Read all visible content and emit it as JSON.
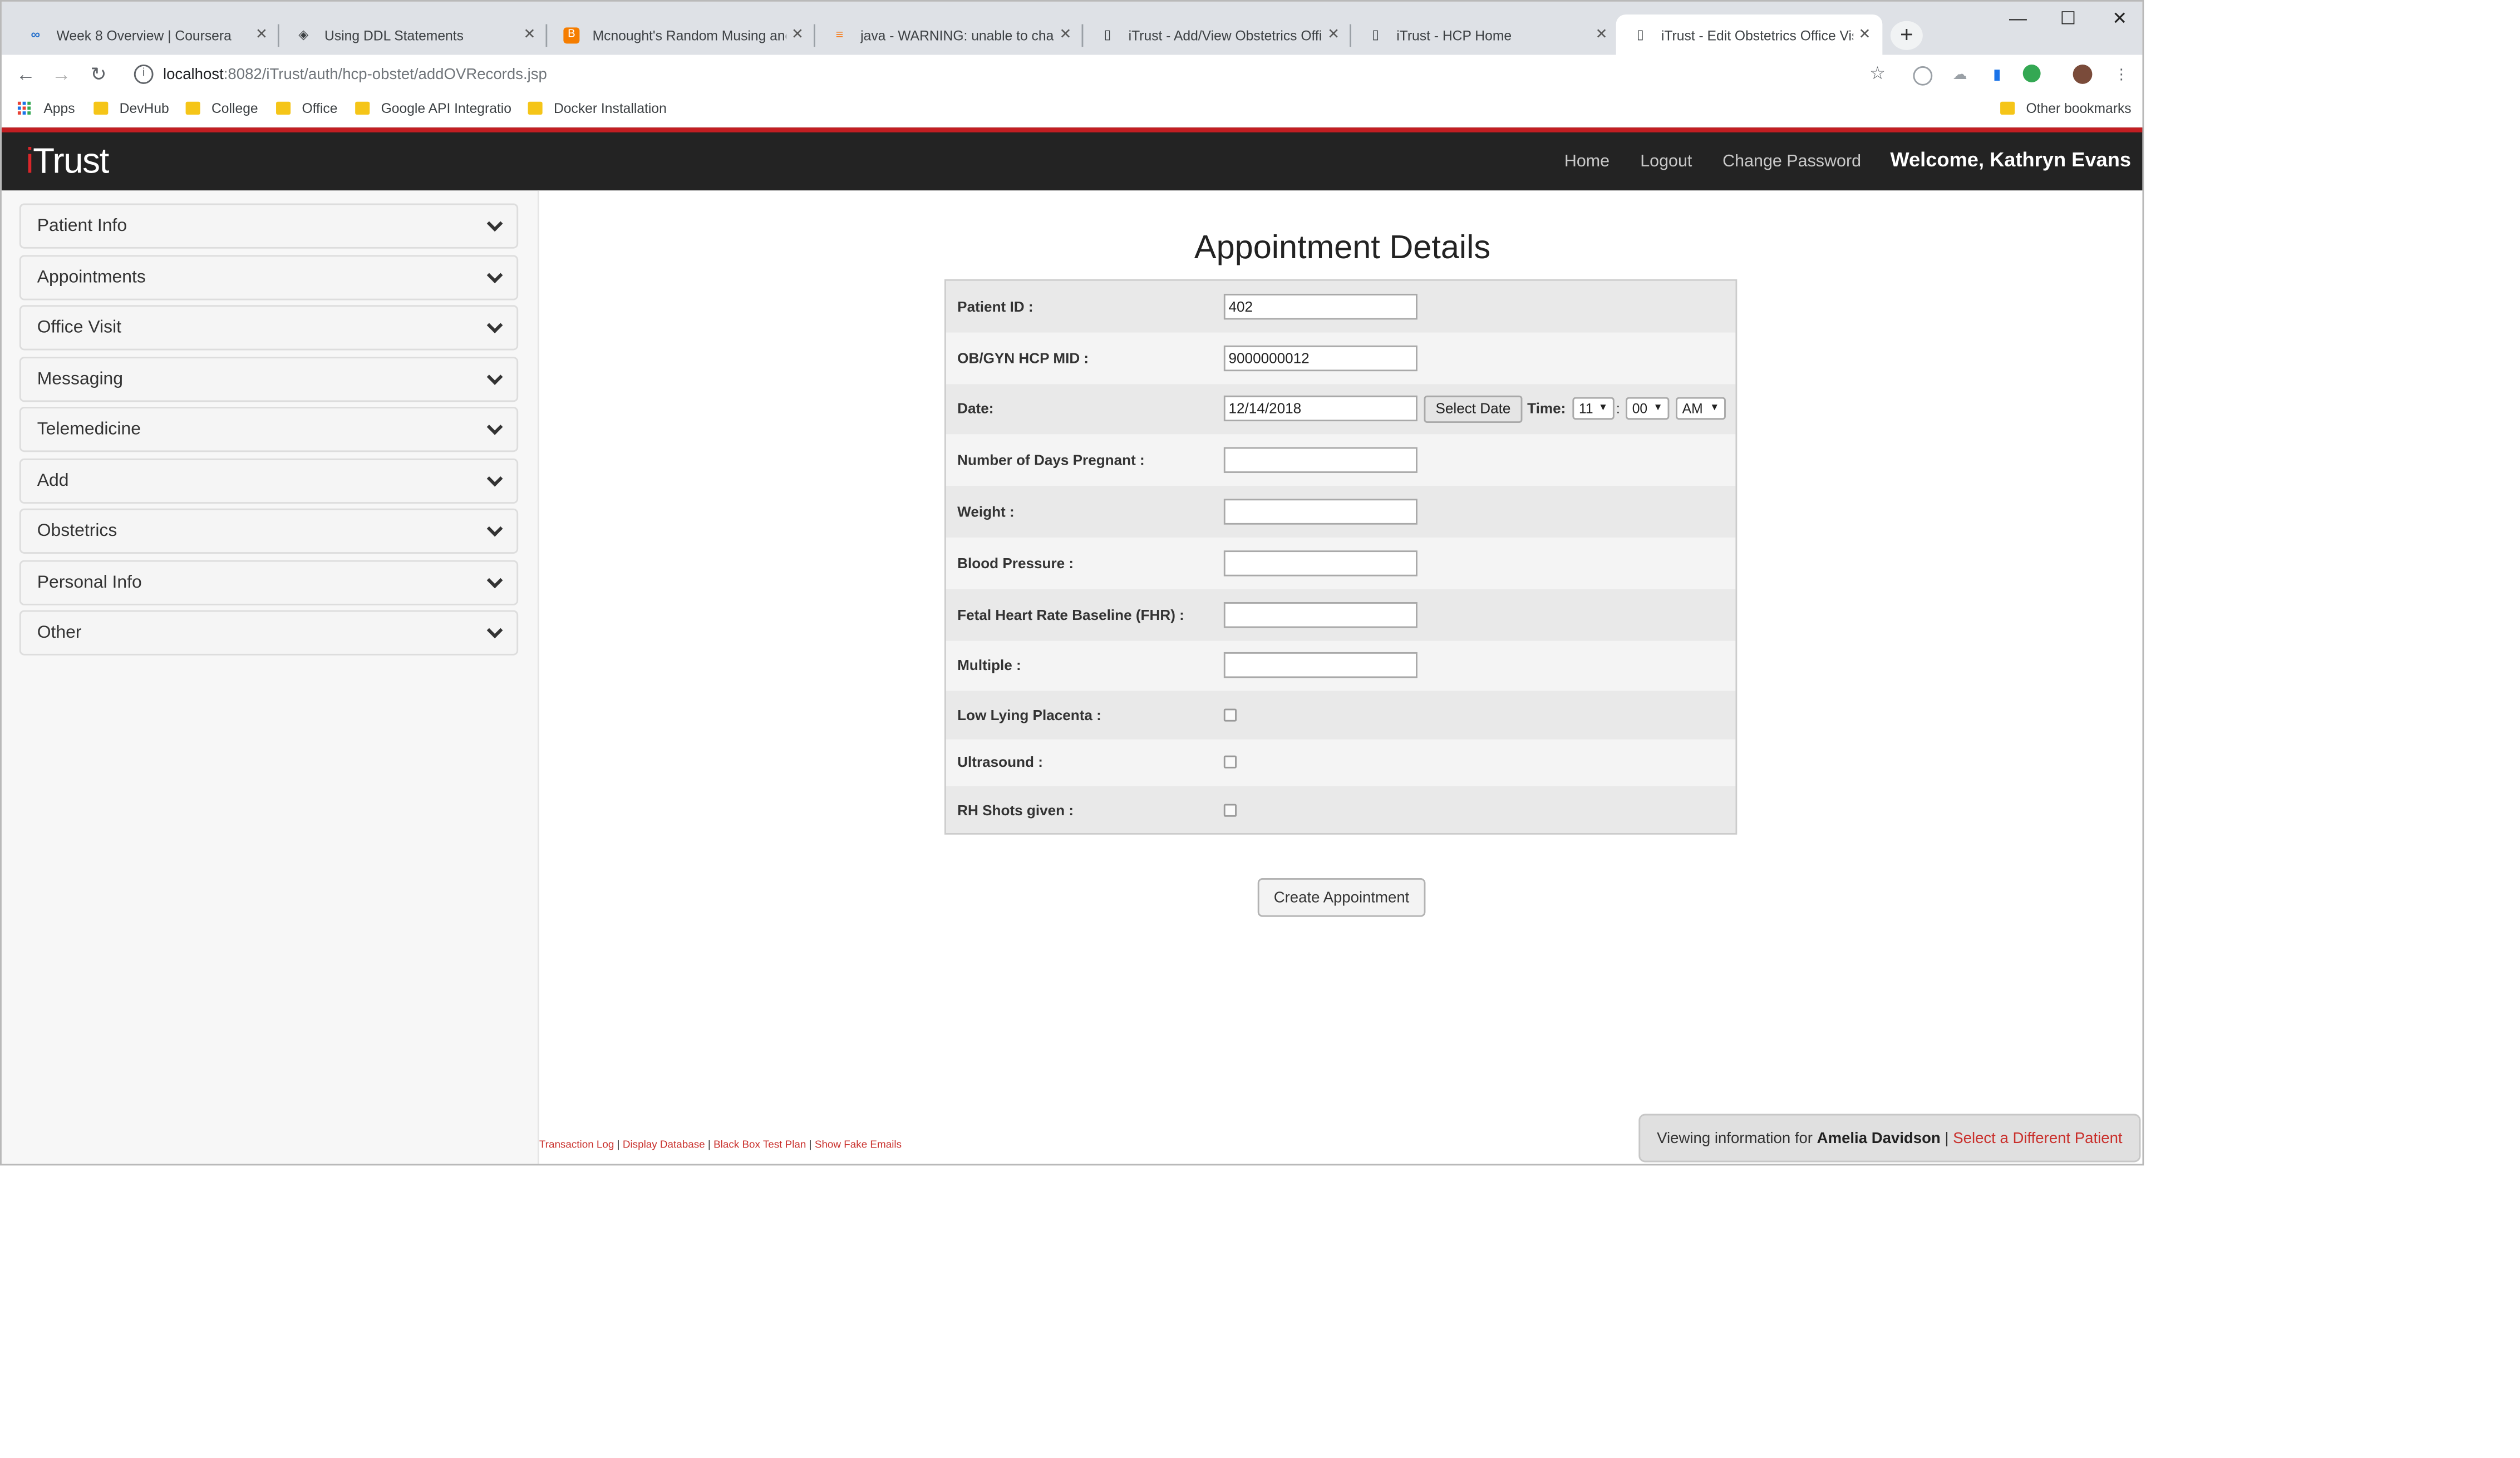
{
  "browser": {
    "tabs": [
      {
        "title": "Week 8 Overview | Coursera",
        "icon": "coursera-icon",
        "active": false
      },
      {
        "title": "Using DDL Statements",
        "icon": "web-icon",
        "active": false
      },
      {
        "title": "Mcnought's Random Musing and",
        "icon": "blogger-icon",
        "active": false
      },
      {
        "title": "java - WARNING: unable to chang",
        "icon": "stackoverflow-icon",
        "active": false
      },
      {
        "title": "iTrust - Add/View Obstetrics Offic",
        "icon": "document-icon",
        "active": false
      },
      {
        "title": "iTrust - HCP Home",
        "icon": "document-icon",
        "active": false
      },
      {
        "title": "iTrust - Edit Obstetrics Office Visi",
        "icon": "document-icon",
        "active": true
      }
    ],
    "tab_close_glyph": "✕",
    "new_tab_glyph": "+",
    "url": {
      "host": "localhost",
      "path": ":8082/iTrust/auth/hcp-obstet/addOVRecords.jsp"
    },
    "bookmarks": [
      {
        "label": "Apps",
        "icon": "apps-icon"
      },
      {
        "label": "DevHub",
        "icon": "folder-icon"
      },
      {
        "label": "College",
        "icon": "folder-icon"
      },
      {
        "label": "Office",
        "icon": "folder-icon"
      },
      {
        "label": "Google API Integratio",
        "icon": "folder-icon"
      },
      {
        "label": "Docker Installation",
        "icon": "folder-icon"
      }
    ],
    "other_bookmarks": "Other bookmarks",
    "colors": {
      "tabstrip": "#dee1e6",
      "active_tab": "#ffffff"
    }
  },
  "navbar": {
    "brand_i": "i",
    "brand_rest": "Trust",
    "links": [
      "Home",
      "Logout",
      "Change Password"
    ],
    "welcome": "Welcome, Kathryn Evans",
    "colors": {
      "background": "#232323",
      "accent": "#c21e22"
    }
  },
  "sidebar": {
    "items": [
      "Patient Info",
      "Appointments",
      "Office Visit",
      "Messaging",
      "Telemedicine",
      "Add",
      "Obstetrics",
      "Personal Info",
      "Other"
    ]
  },
  "form": {
    "title": "Appointment Details",
    "patient_id": {
      "label": "Patient ID :",
      "value": "402"
    },
    "hcp_mid": {
      "label": "OB/GYN HCP MID :",
      "value": "9000000012"
    },
    "date": {
      "label": "Date:",
      "value": "12/14/2018",
      "select_date_label": "Select Date"
    },
    "time": {
      "label": "Time:",
      "hour": "11",
      "minute": "00",
      "ampm": "AM",
      "separator": ":"
    },
    "days_pregnant": {
      "label": "Number of Days Pregnant :",
      "value": ""
    },
    "weight": {
      "label": "Weight :",
      "value": ""
    },
    "blood_pressure": {
      "label": "Blood Pressure :",
      "value": ""
    },
    "fhr": {
      "label": "Fetal Heart Rate Baseline (FHR) :",
      "value": ""
    },
    "multiple": {
      "label": "Multiple :",
      "value": ""
    },
    "low_lying_placenta": {
      "label": "Low Lying Placenta :",
      "checked": false
    },
    "ultrasound": {
      "label": "Ultrasound :",
      "checked": false
    },
    "rh_shots": {
      "label": "RH Shots given :",
      "checked": false
    },
    "submit_label": "Create Appointment"
  },
  "footer": {
    "links": [
      "Transaction Log",
      "Display Database",
      "Black Box Test Plan",
      "Show Fake Emails"
    ],
    "separator": "|"
  },
  "viewing": {
    "prefix": "Viewing information for",
    "patient": "Amelia Davidson",
    "separator": "|",
    "link": "Select a Different Patient"
  }
}
